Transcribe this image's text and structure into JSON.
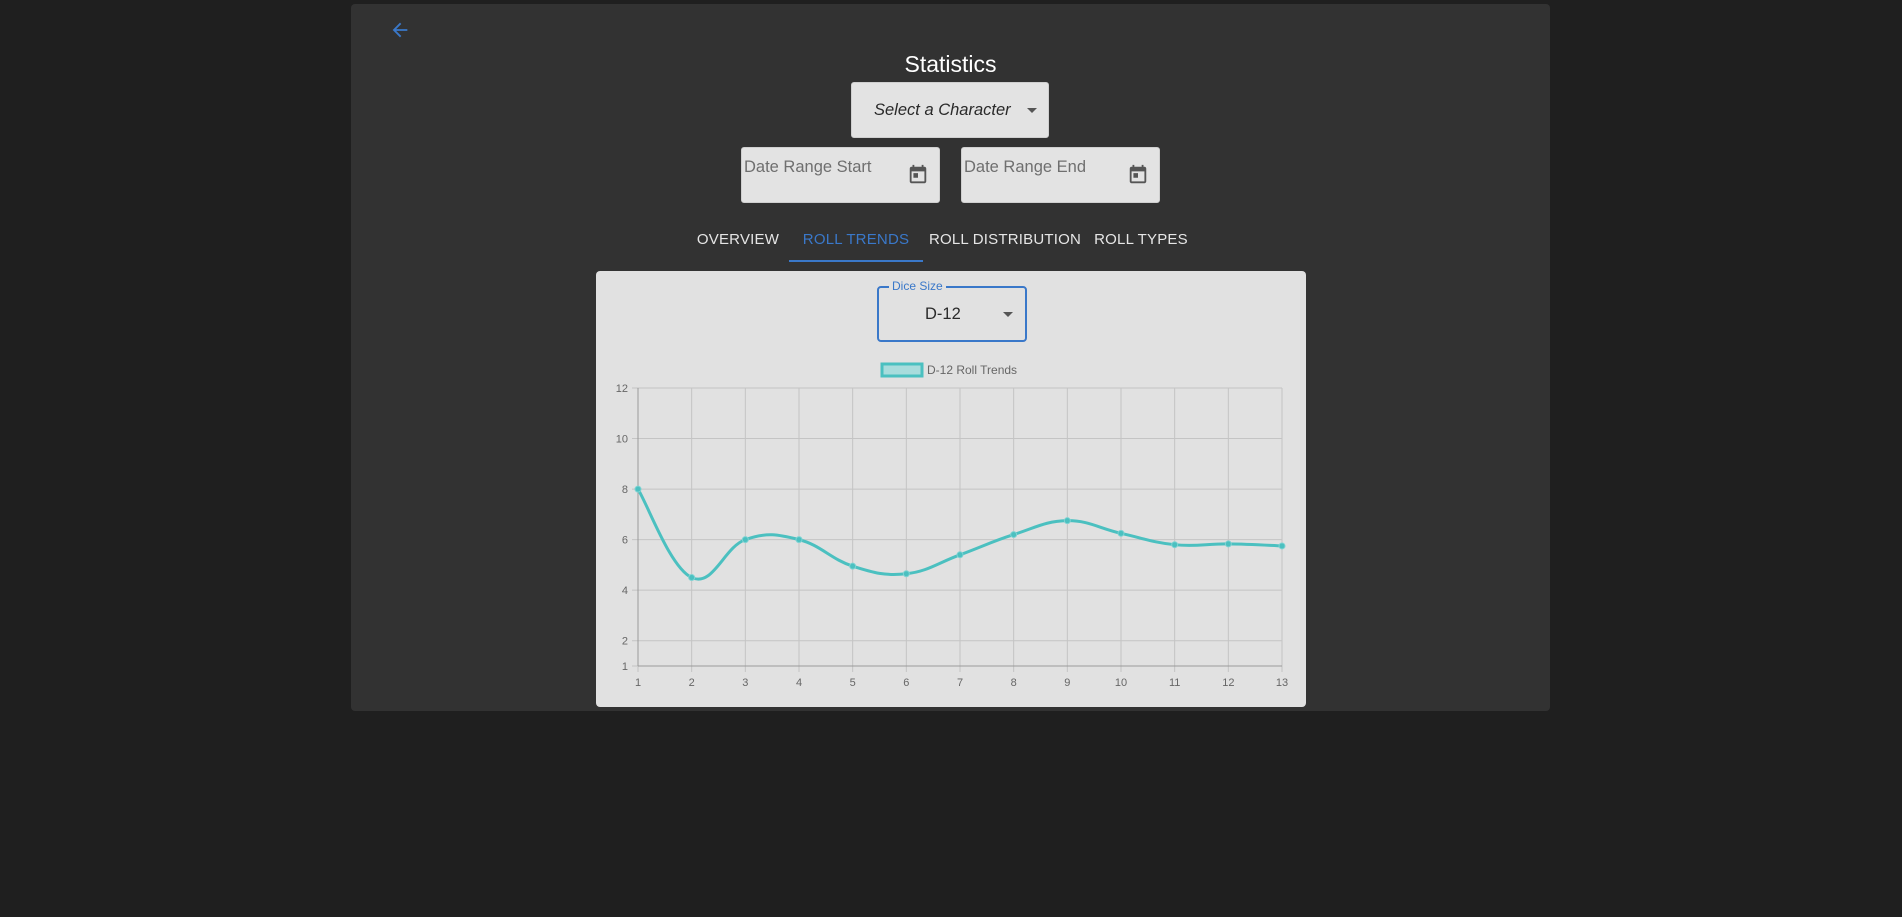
{
  "header": {
    "title": "Statistics",
    "back_icon": "arrow-left-icon",
    "accent_color": "#3a78c9"
  },
  "filters": {
    "character_select": {
      "value": "Select a Character"
    },
    "date_start": {
      "placeholder": "Date Range Start",
      "icon": "calendar-icon"
    },
    "date_end": {
      "placeholder": "Date Range End",
      "icon": "calendar-icon"
    }
  },
  "tabs": [
    {
      "label": "OVERVIEW",
      "active": false
    },
    {
      "label": "ROLL TRENDS",
      "active": true
    },
    {
      "label": "ROLL DISTRIBUTION",
      "active": false
    },
    {
      "label": "ROLL TYPES",
      "active": false
    }
  ],
  "dice_select": {
    "label": "Dice Size",
    "value": "D-12"
  },
  "chart_data": {
    "type": "line",
    "x": [
      1,
      2,
      3,
      4,
      5,
      6,
      7,
      8,
      9,
      10,
      11,
      12,
      13
    ],
    "series": [
      {
        "name": "D-12 Roll Trends",
        "values": [
          8,
          4.5,
          6,
          6,
          4.95,
          4.65,
          5.4,
          6.2,
          6.75,
          6.25,
          5.8,
          5.83,
          5.75
        ],
        "color": "#4bc0c0"
      }
    ],
    "yticks": [
      1,
      2,
      4,
      6,
      8,
      10,
      12
    ],
    "xlim": [
      1,
      13
    ],
    "ylim": [
      1,
      12
    ],
    "grid": true,
    "legend": "top-center"
  }
}
